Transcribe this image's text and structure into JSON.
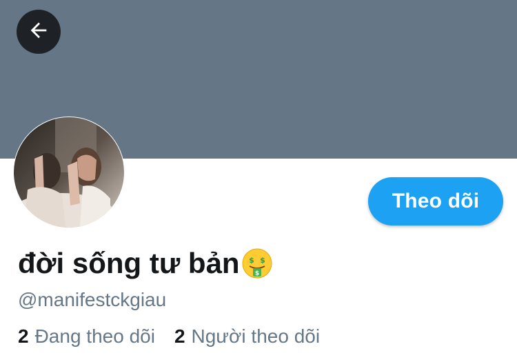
{
  "header": {
    "back_icon": "arrow-left-icon",
    "banner_color": "#657786"
  },
  "profile": {
    "display_name": "đời sống tư bản",
    "name_emoji": "money-mouth-face-icon",
    "handle": "@manifestckgiau",
    "avatar_alt": "profile photo"
  },
  "actions": {
    "follow_label": "Theo dõi",
    "accent_color": "#1da1f2"
  },
  "stats": {
    "following_count": "2",
    "following_label": "Đang theo dõi",
    "followers_count": "2",
    "followers_label": "Người theo dõi"
  }
}
